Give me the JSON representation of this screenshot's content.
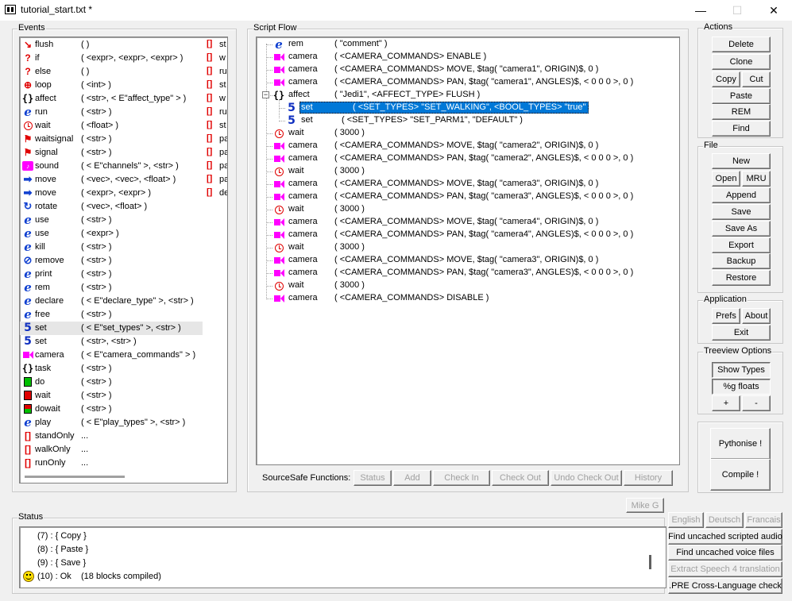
{
  "window": {
    "title": "tutorial_start.txt *",
    "minimize": "—",
    "maximize": "☐",
    "close": "✕"
  },
  "events": {
    "label": "Events",
    "items": [
      {
        "icon": "flush-icon",
        "name": "flush",
        "args": "(    )"
      },
      {
        "icon": "if-icon",
        "name": "if",
        "args": "( <expr>, <expr>, <expr> )"
      },
      {
        "icon": "else-icon",
        "name": "else",
        "args": "(    )"
      },
      {
        "icon": "loop-icon",
        "name": "loop",
        "args": "( <int> )"
      },
      {
        "icon": "affect-icon",
        "name": "affect",
        "args": "( <str>, < E\"affect_type\" > )"
      },
      {
        "icon": "run-icon",
        "name": "run",
        "args": "( <str> )"
      },
      {
        "icon": "wait-icon",
        "name": "wait",
        "args": "( <float> )"
      },
      {
        "icon": "waitsignal-icon",
        "name": "waitsignal",
        "args": "( <str> )"
      },
      {
        "icon": "signal-icon",
        "name": "signal",
        "args": "( <str> )"
      },
      {
        "icon": "sound-icon",
        "name": "sound",
        "args": "( < E\"channels\" >, <str> )"
      },
      {
        "icon": "move-icon",
        "name": "move",
        "args": "( <vec>, <vec>, <float> )"
      },
      {
        "icon": "move-icon",
        "name": "move",
        "args": "( <expr>, <expr> )"
      },
      {
        "icon": "rotate-icon",
        "name": "rotate",
        "args": "( <vec>, <float> )"
      },
      {
        "icon": "use-icon",
        "name": "use",
        "args": "( <str> )"
      },
      {
        "icon": "use-icon",
        "name": "use",
        "args": "( <expr> )"
      },
      {
        "icon": "kill-icon",
        "name": "kill",
        "args": "( <str> )"
      },
      {
        "icon": "remove-icon",
        "name": "remove",
        "args": "( <str> )"
      },
      {
        "icon": "print-icon",
        "name": "print",
        "args": "( <str> )"
      },
      {
        "icon": "rem-icon",
        "name": "rem",
        "args": "( <str> )"
      },
      {
        "icon": "declare-icon",
        "name": "declare",
        "args": "( < E\"declare_type\" >, <str> )"
      },
      {
        "icon": "free-icon",
        "name": "free",
        "args": "( <str> )"
      },
      {
        "icon": "set-icon",
        "name": "set",
        "args": "( < E\"set_types\" >, <str> )"
      },
      {
        "icon": "set-icon",
        "name": "set",
        "args": "( <str>, <str> )"
      },
      {
        "icon": "camera-icon",
        "name": "camera",
        "args": "( < E\"camera_commands\" > )"
      },
      {
        "icon": "task-icon",
        "name": "task",
        "args": "( <str> )"
      },
      {
        "icon": "do-icon",
        "name": "do",
        "args": "( <str> )"
      },
      {
        "icon": "wait-block-icon",
        "name": "wait",
        "args": "( <str> )"
      },
      {
        "icon": "dowait-icon",
        "name": "dowait",
        "args": "( <str> )"
      },
      {
        "icon": "play-icon",
        "name": "play",
        "args": "( < E\"play_types\" >, <str> )"
      },
      {
        "icon": "bracket-icon",
        "name": "standOnly",
        "args": "..."
      },
      {
        "icon": "bracket-icon",
        "name": "walkOnly",
        "args": "..."
      },
      {
        "icon": "bracket-icon",
        "name": "runOnly",
        "args": "..."
      }
    ],
    "second_column": [
      "st",
      "w",
      "ru",
      "st",
      "w",
      "ru",
      "st",
      "pa",
      "pa",
      "pa",
      "pa",
      "de"
    ]
  },
  "script_flow": {
    "label": "Script Flow",
    "rows": [
      {
        "icon": "rem-icon",
        "name": "rem",
        "args": "( \"comment\" )",
        "level": 0
      },
      {
        "icon": "camera-icon",
        "name": "camera",
        "args": "( <CAMERA_COMMANDS> ENABLE )",
        "level": 0
      },
      {
        "icon": "camera-icon",
        "name": "camera",
        "args": "( <CAMERA_COMMANDS> MOVE, $tag( \"camera1\", ORIGIN)$, 0 )",
        "level": 0
      },
      {
        "icon": "camera-icon",
        "name": "camera",
        "args": "( <CAMERA_COMMANDS> PAN, $tag( \"camera1\", ANGLES)$, < 0 0 0 >, 0 )",
        "level": 0
      },
      {
        "icon": "affect-icon",
        "name": "affect",
        "args": "( \"Jedi1\", <AFFECT_TYPE> FLUSH )",
        "level": 0,
        "expander": "−"
      },
      {
        "icon": "set-icon",
        "name": "set",
        "args": "( <SET_TYPES> \"SET_WALKING\", <BOOL_TYPES> \"true\" )",
        "level": 1,
        "selected": true
      },
      {
        "icon": "set-icon",
        "name": "set",
        "args": "( <SET_TYPES> \"SET_PARM1\", \"DEFAULT\" )",
        "level": 1
      },
      {
        "icon": "wait-icon",
        "name": "wait",
        "args": "( 3000 )",
        "level": 0
      },
      {
        "icon": "camera-icon",
        "name": "camera",
        "args": "( <CAMERA_COMMANDS> MOVE, $tag( \"camera2\", ORIGIN)$, 0 )",
        "level": 0
      },
      {
        "icon": "camera-icon",
        "name": "camera",
        "args": "( <CAMERA_COMMANDS> PAN, $tag( \"camera2\", ANGLES)$, < 0 0 0 >, 0 )",
        "level": 0
      },
      {
        "icon": "wait-icon",
        "name": "wait",
        "args": "( 3000 )",
        "level": 0
      },
      {
        "icon": "camera-icon",
        "name": "camera",
        "args": "( <CAMERA_COMMANDS> MOVE, $tag( \"camera3\", ORIGIN)$, 0 )",
        "level": 0
      },
      {
        "icon": "camera-icon",
        "name": "camera",
        "args": "( <CAMERA_COMMANDS> PAN, $tag( \"camera3\", ANGLES)$, < 0 0 0 >, 0 )",
        "level": 0
      },
      {
        "icon": "wait-icon",
        "name": "wait",
        "args": "( 3000 )",
        "level": 0
      },
      {
        "icon": "camera-icon",
        "name": "camera",
        "args": "( <CAMERA_COMMANDS> MOVE, $tag( \"camera4\", ORIGIN)$, 0 )",
        "level": 0
      },
      {
        "icon": "camera-icon",
        "name": "camera",
        "args": "( <CAMERA_COMMANDS> PAN, $tag( \"camera4\", ANGLES)$, < 0 0 0 >, 0 )",
        "level": 0
      },
      {
        "icon": "wait-icon",
        "name": "wait",
        "args": "( 3000 )",
        "level": 0
      },
      {
        "icon": "camera-icon",
        "name": "camera",
        "args": "( <CAMERA_COMMANDS> MOVE, $tag( \"camera3\", ORIGIN)$, 0 )",
        "level": 0
      },
      {
        "icon": "camera-icon",
        "name": "camera",
        "args": "( <CAMERA_COMMANDS> PAN, $tag( \"camera3\", ANGLES)$, < 0 0 0 >, 0 )",
        "level": 0
      },
      {
        "icon": "wait-icon",
        "name": "wait",
        "args": "( 3000 )",
        "level": 0
      },
      {
        "icon": "camera-icon",
        "name": "camera",
        "args": "( <CAMERA_COMMANDS> DISABLE )",
        "level": 0
      }
    ]
  },
  "sourcesafe": {
    "label": "SourceSafe Functions:",
    "buttons": [
      "Status",
      "Add",
      "Check In",
      "Check Out",
      "Undo Check Out",
      "History"
    ]
  },
  "actions": {
    "label": "Actions",
    "delete": "Delete",
    "clone": "Clone",
    "copy": "Copy",
    "cut": "Cut",
    "paste": "Paste",
    "rem": "REM",
    "find": "Find"
  },
  "file": {
    "label": "File",
    "new": "New",
    "open": "Open",
    "mru": "MRU",
    "append": "Append",
    "save": "Save",
    "save_as": "Save As",
    "export": "Export",
    "backup": "Backup",
    "restore": "Restore"
  },
  "application": {
    "label": "Application",
    "prefs": "Prefs",
    "about": "About",
    "exit": "Exit"
  },
  "treeview": {
    "label": "Treeview Options",
    "show_types": "Show Types",
    "g_floats": "%g floats",
    "plus": "+",
    "minus": "-"
  },
  "compile": {
    "pythonise": "Pythonise !",
    "compile": "Compile !"
  },
  "user_badge": "Mike G",
  "status": {
    "label": "Status",
    "lines": [
      {
        "text": "(7) : { Copy }",
        "icon": ""
      },
      {
        "text": "(8) : { Paste }",
        "icon": ""
      },
      {
        "text": "(9) : { Save }",
        "icon": ""
      },
      {
        "text": "(10) : Ok    (18 blocks compiled)",
        "icon": "smiley-icon"
      }
    ]
  },
  "language": {
    "english": "English",
    "deutsch": "Deutsch",
    "francais": "Francais"
  },
  "tools": {
    "find_uncached_audio": "Find uncached scripted audio",
    "find_uncached_voice": "Find uncached voice files",
    "extract_speech": "Extract Speech 4 translation",
    "pre_check": ".PRE Cross-Language check"
  }
}
